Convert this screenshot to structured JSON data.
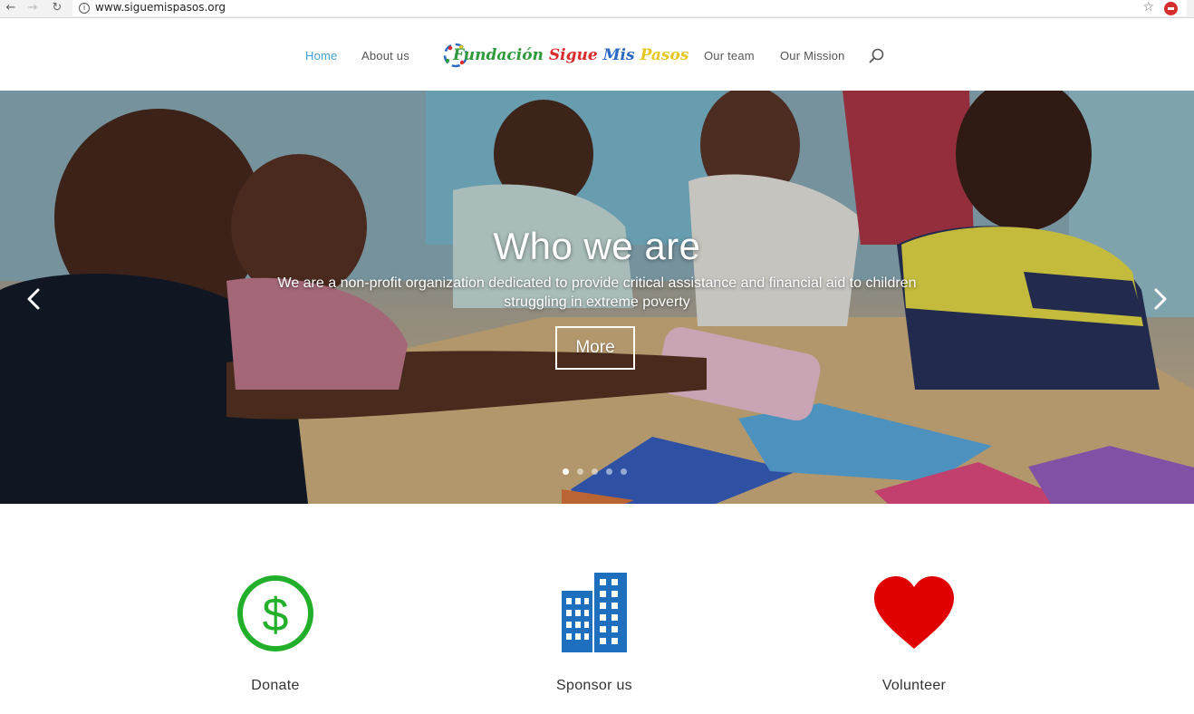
{
  "browser": {
    "url": "www.siguemispasos.org",
    "back_icon": "back-arrow-icon",
    "forward_icon": "forward-arrow-icon",
    "reload_icon": "reload-icon",
    "site_info_icon": "info-icon",
    "bookmark_icon": "star-icon",
    "extension_icon": "adblock-icon"
  },
  "header": {
    "nav_left": [
      {
        "label": "Home",
        "active": true
      },
      {
        "label": "About us",
        "active": false
      }
    ],
    "logo": {
      "words": [
        "Fundación",
        "Sigue",
        "Mis",
        "Pasos"
      ],
      "colors": [
        "#2e9a3a",
        "#d92b2b",
        "#2969c4",
        "#e8c620"
      ]
    },
    "nav_right": [
      {
        "label": "Our team"
      },
      {
        "label": "Our Mission"
      }
    ],
    "search_icon": "search-icon",
    "active_color": "#3fa0d6"
  },
  "hero": {
    "title": "Who we are",
    "subtitle_line1": "We are a non-profit organization dedicated to provide critical assistance and financial aid to children",
    "subtitle_line2": "struggling in extreme poverty",
    "button_label": "More",
    "prev_icon": "chevron-left-icon",
    "next_icon": "chevron-right-icon",
    "slide_count": 5,
    "active_slide": 1
  },
  "features": [
    {
      "label": "Donate",
      "icon": "dollar-circle-icon",
      "color": "#22b02a"
    },
    {
      "label": "Sponsor us",
      "icon": "building-icon",
      "color": "#1e6fbe"
    },
    {
      "label": "Volunteer",
      "icon": "heart-icon",
      "color": "#e00000"
    }
  ]
}
